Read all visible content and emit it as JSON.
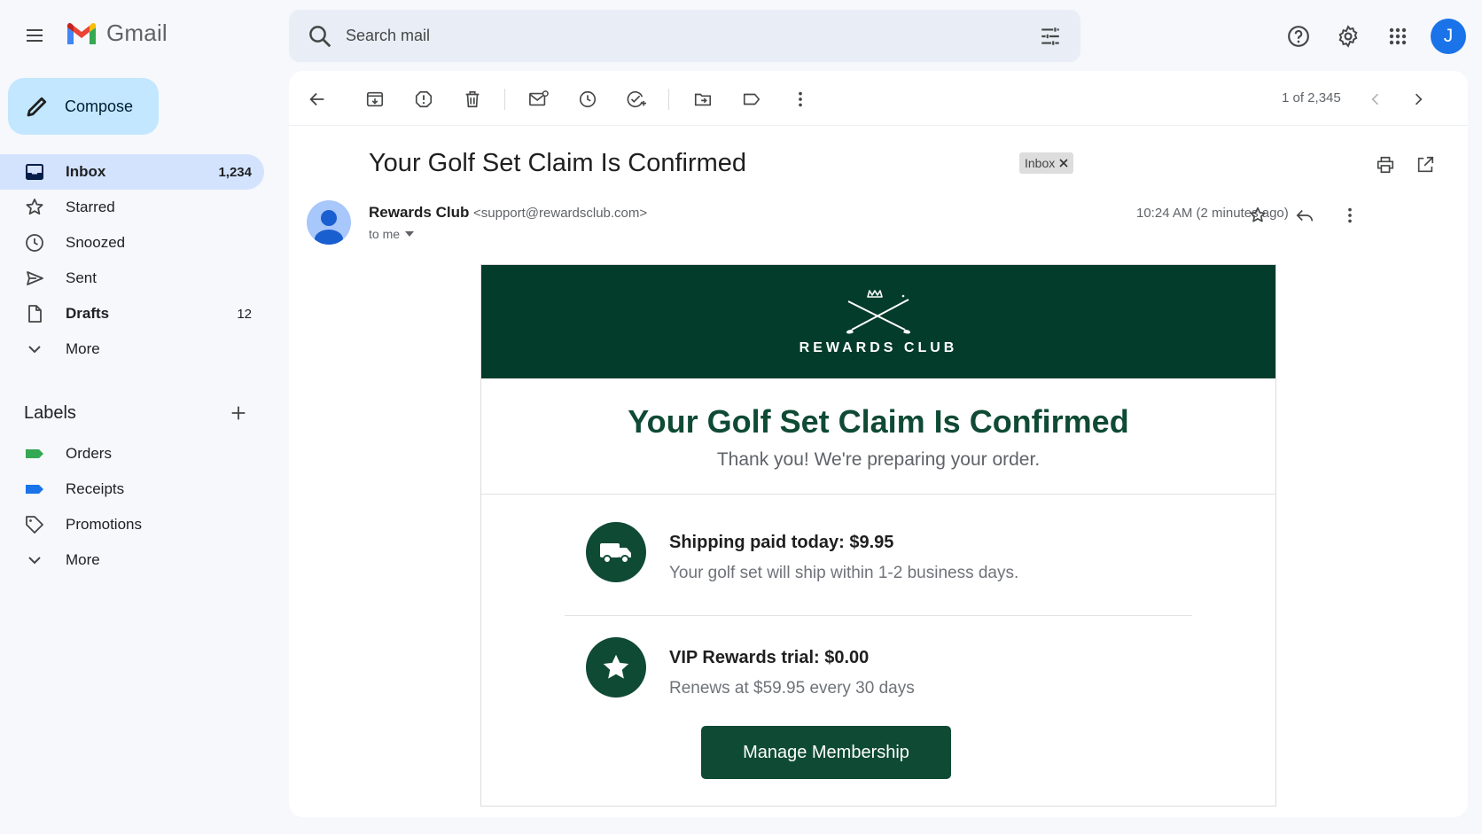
{
  "app": {
    "name": "Gmail"
  },
  "search": {
    "placeholder": "Search mail"
  },
  "user": {
    "initial": "J"
  },
  "compose": {
    "label": "Compose"
  },
  "nav": [
    {
      "key": "inbox",
      "label": "Inbox",
      "count": "1,234",
      "icon": "inbox-icon"
    },
    {
      "key": "starred",
      "label": "Starred",
      "count": "",
      "icon": "star-icon"
    },
    {
      "key": "snoozed",
      "label": "Snoozed",
      "count": "",
      "icon": "clock-icon"
    },
    {
      "key": "sent",
      "label": "Sent",
      "count": "",
      "icon": "send-icon"
    },
    {
      "key": "drafts",
      "label": "Drafts",
      "count": "12",
      "icon": "draft-icon"
    },
    {
      "key": "more",
      "label": "More",
      "count": "",
      "icon": "chevron-down-icon"
    }
  ],
  "labels": {
    "title": "Labels",
    "items": [
      {
        "label": "Orders",
        "color": "#34a853"
      },
      {
        "label": "Receipts",
        "color": "#1a73e8"
      },
      {
        "label": "Promotions",
        "color": ""
      },
      {
        "label": "More",
        "color": ""
      }
    ]
  },
  "toolbar": {
    "pager": "1 of 2,345"
  },
  "email": {
    "subject": "Your Golf Set Claim Is Confirmed",
    "tag": "Inbox",
    "sender_name": "Rewards Club",
    "sender_email": "<support@rewardsclub.com>",
    "to": "to me",
    "time": "10:24 AM (2 minutes ago)"
  },
  "body": {
    "brand": "REWARDS CLUB",
    "headline": "Your Golf Set Claim Is Confirmed",
    "subheadline": "Thank you! We're preparing your order.",
    "items": [
      {
        "title": "Shipping paid today: $9.95",
        "desc": "Your golf set will ship within 1-2 business days.",
        "icon": "truck-icon"
      },
      {
        "title": "VIP Rewards trial: $0.00",
        "desc": "Renews at $59.95 every 30 days",
        "icon": "star-icon"
      }
    ],
    "cta": "Manage Membership"
  },
  "colors": {
    "brand_green": "#033c2a",
    "accent_green": "#0f4a35",
    "compose_bg": "#c2e7ff",
    "active_nav": "#d3e3fd"
  }
}
